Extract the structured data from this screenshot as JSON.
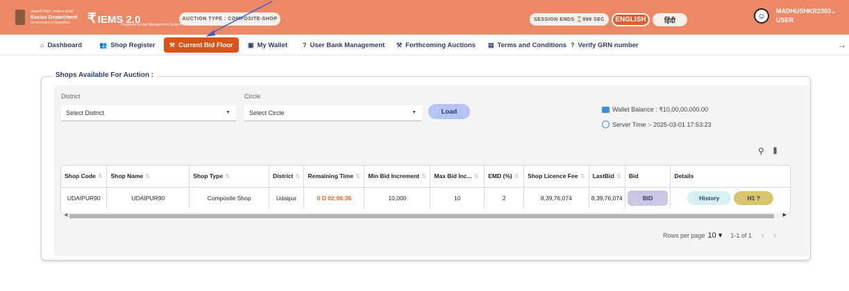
{
  "header": {
    "dept_line1": "आबकारी विभाग, राजस्थान सरकार",
    "dept_name": "Excise Department",
    "dept_line3": "Government of Rajasthan",
    "app_name": "IEMS 2.0",
    "app_subtitle": "Integrated Excise Management System",
    "auction_type": "AUCTION TYPE : COMPOSITE-SHOP",
    "session": "SESSION ENDS ⌛898 SEC",
    "lang_en": "ENGLISH",
    "lang_hi": "हिंदी",
    "user_name": "MADHUSHKR2303",
    "user_role": "USER"
  },
  "nav": {
    "items": [
      {
        "label": "Dashboard",
        "icon": "home-icon"
      },
      {
        "label": "Shop Register",
        "icon": "users-icon"
      },
      {
        "label": "Current Bid Floor",
        "icon": "gavel-icon"
      },
      {
        "label": "My Wallet",
        "icon": "wallet-icon"
      },
      {
        "label": "User Bank Management",
        "icon": "help-icon"
      },
      {
        "label": "Forthcoming Auctions",
        "icon": "gavel-icon"
      },
      {
        "label": "Terms and Conditions",
        "icon": "document-icon"
      },
      {
        "label": "Verify GRN number",
        "icon": "help-icon"
      }
    ]
  },
  "panel": {
    "legend": "Shops Available For Auction :",
    "district_label": "District",
    "district_value": "Select District",
    "circle_label": "Circle",
    "circle_value": "Select Circle",
    "load_label": "Load",
    "wallet_balance": "Wallet Balance : ₹10,00,00,000.00",
    "server_time": "Server Time :- 2025-03-01 17:53:23"
  },
  "table": {
    "headers": [
      "Shop Code",
      "Shop Name",
      "Shop Type",
      "District",
      "Remaining Time",
      "Min Bid Increment",
      "Max Bid Inc...",
      "EMD (%)",
      "Shop Licence Fee",
      "LastBid",
      "Bid",
      "Details"
    ],
    "rows": [
      {
        "shop_code": "UDAIPUR90",
        "shop_name": "UDAIPUR90",
        "shop_type": "Composite Shop",
        "district": "Udaipur",
        "remaining_time": "0 D 02:06:36",
        "min_bid_increment": "10,000",
        "max_bid_inc": "10",
        "emd": "2",
        "licence_fee": "8,39,76,074",
        "last_bid": "8,39,76,074",
        "bid_label": "BID",
        "history_label": "History",
        "h1_label": "H1 ?"
      }
    ]
  },
  "pagination": {
    "rows_per_page_label": "Rows per page",
    "rows_per_page": "10",
    "range": "1-1 of 1"
  },
  "colors": {
    "header_bg": "#ec8866",
    "active_nav": "#d8541b",
    "remaining_time": "#e2641c"
  }
}
